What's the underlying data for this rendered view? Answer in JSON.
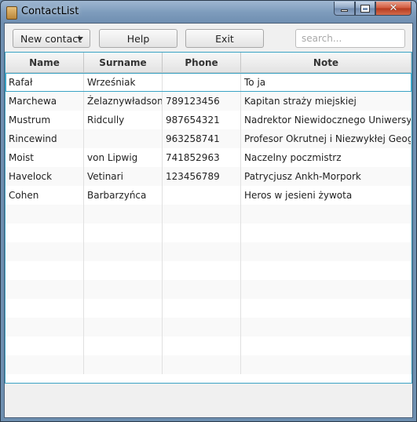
{
  "window": {
    "title": "ContactList",
    "controls": {
      "minimize": "minimize",
      "maximize": "maximize",
      "close": "✕"
    }
  },
  "toolbar": {
    "new_contact_label": "New contact",
    "help_label": "Help",
    "exit_label": "Exit",
    "search_placeholder": "search..."
  },
  "table": {
    "columns": [
      "Name",
      "Surname",
      "Phone",
      "Note"
    ],
    "rows": [
      [
        "Rafał",
        "Wrześniak",
        "",
        "To ja"
      ],
      [
        "Marchewa",
        "Żelaznywładson",
        "789123456",
        "Kapitan straży miejskiej"
      ],
      [
        "Mustrum",
        "Ridcully",
        "987654321",
        "Nadrektor Niewidocznego Uniwersytetu"
      ],
      [
        "Rincewind",
        "",
        "963258741",
        "Profesor Okrutnej i Niezwykłej Geografii"
      ],
      [
        "Moist",
        "von Lipwig",
        "741852963",
        "Naczelny poczmistrz"
      ],
      [
        "Havelock",
        "Vetinari",
        "123456789",
        "Patrycjusz Ankh-Morpork"
      ],
      [
        "Cohen",
        "Barbarzyńca",
        "",
        "Heros w jesieni żywota"
      ]
    ],
    "empty_rows": 9,
    "selected_row": 0
  },
  "colors": {
    "accent": "#3aa3c5",
    "titlebar": "#6e8fb0",
    "close": "#c9432a"
  }
}
